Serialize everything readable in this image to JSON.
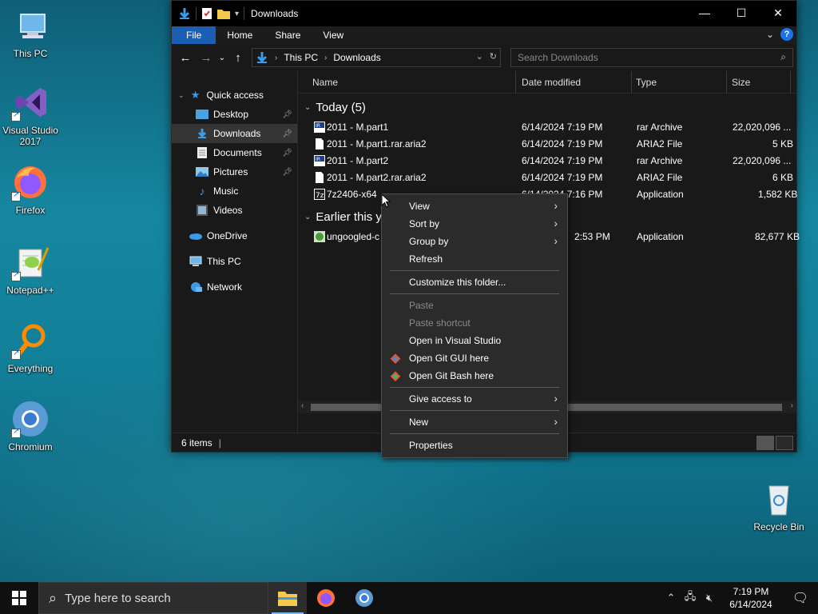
{
  "desktop": {
    "icons": [
      {
        "label": "This PC"
      },
      {
        "label": "Visual Studio 2017"
      },
      {
        "label": "Firefox"
      },
      {
        "label": "Notepad++"
      },
      {
        "label": "Everything"
      },
      {
        "label": "Chromium"
      },
      {
        "label": "Recycle Bin"
      }
    ]
  },
  "window": {
    "title": "Downloads",
    "controls": {
      "minimize": "—",
      "maximize": "☐",
      "close": "✕"
    },
    "ribbon_tabs": [
      "File",
      "Home",
      "Share",
      "View"
    ],
    "help": "?",
    "address": {
      "crumbs": [
        "This PC",
        "Downloads"
      ]
    },
    "search_placeholder": "Search Downloads",
    "nav": {
      "quick_access": "Quick access",
      "items": [
        "Desktop",
        "Downloads",
        "Documents",
        "Pictures",
        "Music",
        "Videos"
      ],
      "onedrive": "OneDrive",
      "this_pc": "This PC",
      "network": "Network"
    },
    "columns": {
      "name": "Name",
      "date": "Date modified",
      "type": "Type",
      "size": "Size"
    },
    "groups": {
      "today": "Today (5)",
      "earlier": "Earlier this year (1)",
      "earlier_visible": "Earlier this ye"
    },
    "files": [
      {
        "name": "2011 - M.part1",
        "date": "6/14/2024 7:19 PM",
        "type": "rar Archive",
        "size": "22,020,096 ..."
      },
      {
        "name": "2011 - M.part1.rar.aria2",
        "date": "6/14/2024 7:19 PM",
        "type": "ARIA2 File",
        "size": "5 KB"
      },
      {
        "name": "2011 - M.part2",
        "date": "6/14/2024 7:19 PM",
        "type": "rar Archive",
        "size": "22,020,096 ..."
      },
      {
        "name": "2011 - M.part2.rar.aria2",
        "date": "6/14/2024 7:19 PM",
        "type": "ARIA2 File",
        "size": "6 KB"
      },
      {
        "name": "7z2406-x64",
        "date": "6/14/2024 7:16 PM",
        "type": "Application",
        "size": "1,582 KB"
      },
      {
        "name": "ungoogled-c",
        "date": "2:53 PM",
        "type": "Application",
        "size": "82,677 KB"
      }
    ],
    "status": "6 items"
  },
  "context_menu": {
    "items": [
      {
        "label": "View",
        "sub": true
      },
      {
        "label": "Sort by",
        "sub": true
      },
      {
        "label": "Group by",
        "sub": true
      },
      {
        "label": "Refresh"
      },
      {
        "label": "Customize this folder..."
      },
      {
        "label": "Paste",
        "disabled": true
      },
      {
        "label": "Paste shortcut",
        "disabled": true
      },
      {
        "label": "Open in Visual Studio"
      },
      {
        "label": "Open Git GUI here"
      },
      {
        "label": "Open Git Bash here"
      },
      {
        "label": "Give access to",
        "sub": true
      },
      {
        "label": "New",
        "sub": true
      },
      {
        "label": "Properties"
      }
    ]
  },
  "taskbar": {
    "search_placeholder": "Type here to search",
    "time": "7:19 PM",
    "date": "6/14/2024"
  }
}
